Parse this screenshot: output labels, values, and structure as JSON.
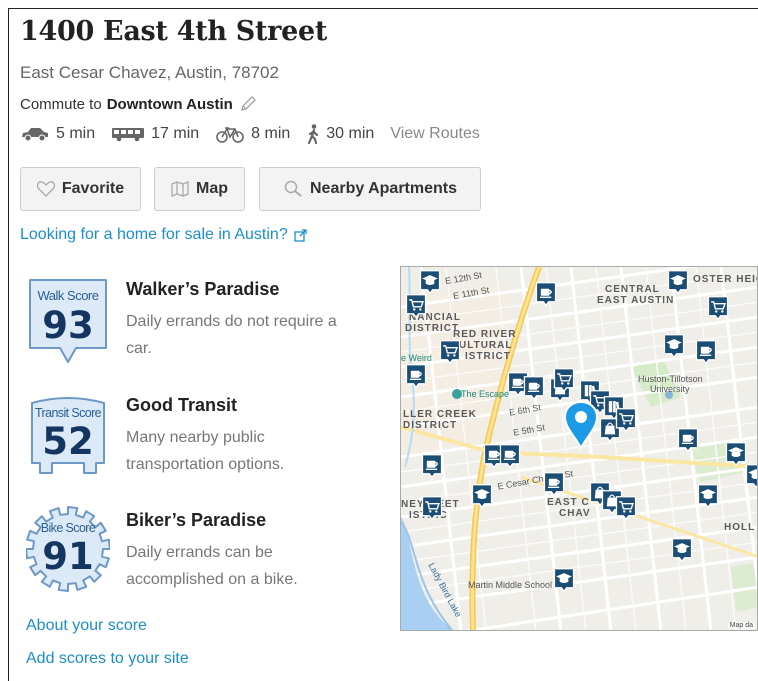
{
  "header": {
    "title": "1400 East 4th Street",
    "address": "East Cesar Chavez, Austin, 78702",
    "commute_prefix": "Commute to",
    "commute_destination": "Downtown Austin"
  },
  "commute_times": {
    "drive": "5 min",
    "transit": "17 min",
    "bike": "8 min",
    "walk": "30 min",
    "view_routes": "View Routes"
  },
  "actions": {
    "favorite": "Favorite",
    "map": "Map",
    "nearby": "Nearby Apartments"
  },
  "home_sale_link": "Looking for a home for sale in Austin?",
  "scores": [
    {
      "badge_label": "Walk Score",
      "value": "93",
      "title": "Walker’s Paradise",
      "description_line1": "Daily errands do not require a",
      "description_line2": "car."
    },
    {
      "badge_label": "Transit Score",
      "value": "52",
      "title": "Good Transit",
      "description_line1": "Many nearby public",
      "description_line2": "transportation options."
    },
    {
      "badge_label": "Bike Score",
      "value": "91",
      "title": "Biker’s Paradise",
      "description_line1": "Daily errands can be",
      "description_line2": "accomplished on a bike."
    }
  ],
  "links": {
    "about": "About your score",
    "add": "Add scores to your site"
  },
  "map": {
    "labels": {
      "central_east_1": "CENTRAL",
      "central_east_2": "EAST AUSTIN",
      "foster": "OSTER HEIG",
      "financial_1": "NANCIAL",
      "financial_2": "DISTRICT",
      "red_river_1": "RED RIVER",
      "red_river_2": "ULTURAL",
      "red_river_3": "ISTRICT",
      "waller_1": "LLER CREEK",
      "waller_2": "DISTRICT",
      "rainey_1": "NEY",
      "rainey_2": "REET",
      "rainey_3": "ISTRIC",
      "east_cesar_1": "EAST C",
      "east_cesar_2": "CHAV",
      "holly": "HOLL",
      "weird": "e Weird",
      "escape": "The Escape",
      "huston_1": "Huston-Tillotson",
      "huston_2": "University",
      "martin": "Martin Middle School",
      "lady_bird": "Lady Bird Lake",
      "cesar_chavez": "E Cesar Chavez St",
      "e_12th": "E 12th St",
      "e_11th": "E 11th St",
      "e_6th": "E 6th St",
      "e_5th": "E 5th St",
      "map_data": "Map da"
    }
  },
  "colors": {
    "link": "#1a8fc9",
    "badge_fill": "#dce9f7",
    "badge_border": "#6e98c6",
    "badge_text": "#13355f",
    "poi": "#1c4d75",
    "pin": "#1d9ae6"
  }
}
